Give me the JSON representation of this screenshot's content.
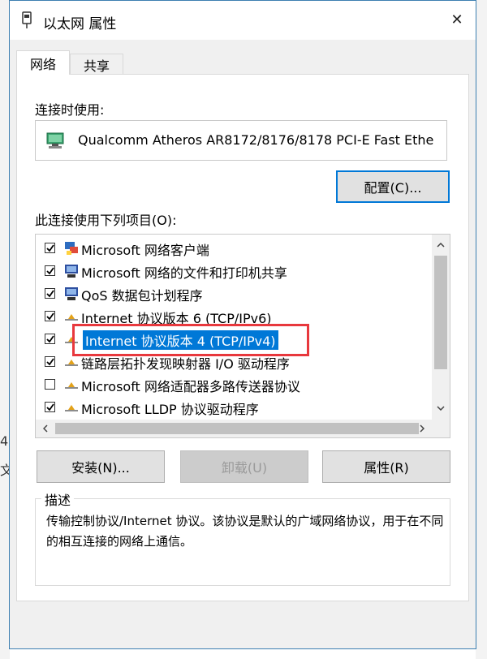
{
  "window": {
    "title": "以太网 属性",
    "close_glyph": "✕"
  },
  "tabs": [
    {
      "label": "网络",
      "active": true
    },
    {
      "label": "共享",
      "active": false
    }
  ],
  "connect_using": {
    "label": "连接时使用:",
    "adapter": "Qualcomm Atheros AR8172/8176/8178 PCI-E Fast Ethe",
    "configure_button": "配置(C)..."
  },
  "items_section": {
    "label": "此连接使用下列项目(O):",
    "items": [
      {
        "label": "Microsoft 网络客户端",
        "checked": true,
        "icon": "network-client-icon"
      },
      {
        "label": "Microsoft 网络的文件和打印机共享",
        "checked": true,
        "icon": "file-printer-sharing-icon"
      },
      {
        "label": "QoS 数据包计划程序",
        "checked": true,
        "icon": "qos-icon"
      },
      {
        "label": "Internet 协议版本 6 (TCP/IPv6)",
        "checked": true,
        "icon": "protocol-icon"
      },
      {
        "label": "Internet 协议版本 4 (TCP/IPv4)",
        "checked": true,
        "icon": "protocol-icon",
        "selected": true
      },
      {
        "label": "链路层拓扑发现映射器 I/O 驱动程序",
        "checked": true,
        "icon": "protocol-icon"
      },
      {
        "label": "Microsoft 网络适配器多路传送器协议",
        "checked": false,
        "icon": "protocol-icon"
      },
      {
        "label": "Microsoft LLDP 协议驱动程序",
        "checked": true,
        "icon": "protocol-icon"
      }
    ]
  },
  "buttons": {
    "install": "安装(N)...",
    "uninstall": "卸载(U)",
    "properties": "属性(R)"
  },
  "description": {
    "title": "描述",
    "text": "传输控制协议/Internet 协议。该协议是默认的广域网络协议，用于在不同的相互连接的网络上通信。"
  },
  "background": {
    "left_marks": [
      "4",
      "文"
    ]
  },
  "colors": {
    "selection": "#0078d7",
    "highlight_border": "#e8383d",
    "primary_button_border": "#0078d7"
  }
}
